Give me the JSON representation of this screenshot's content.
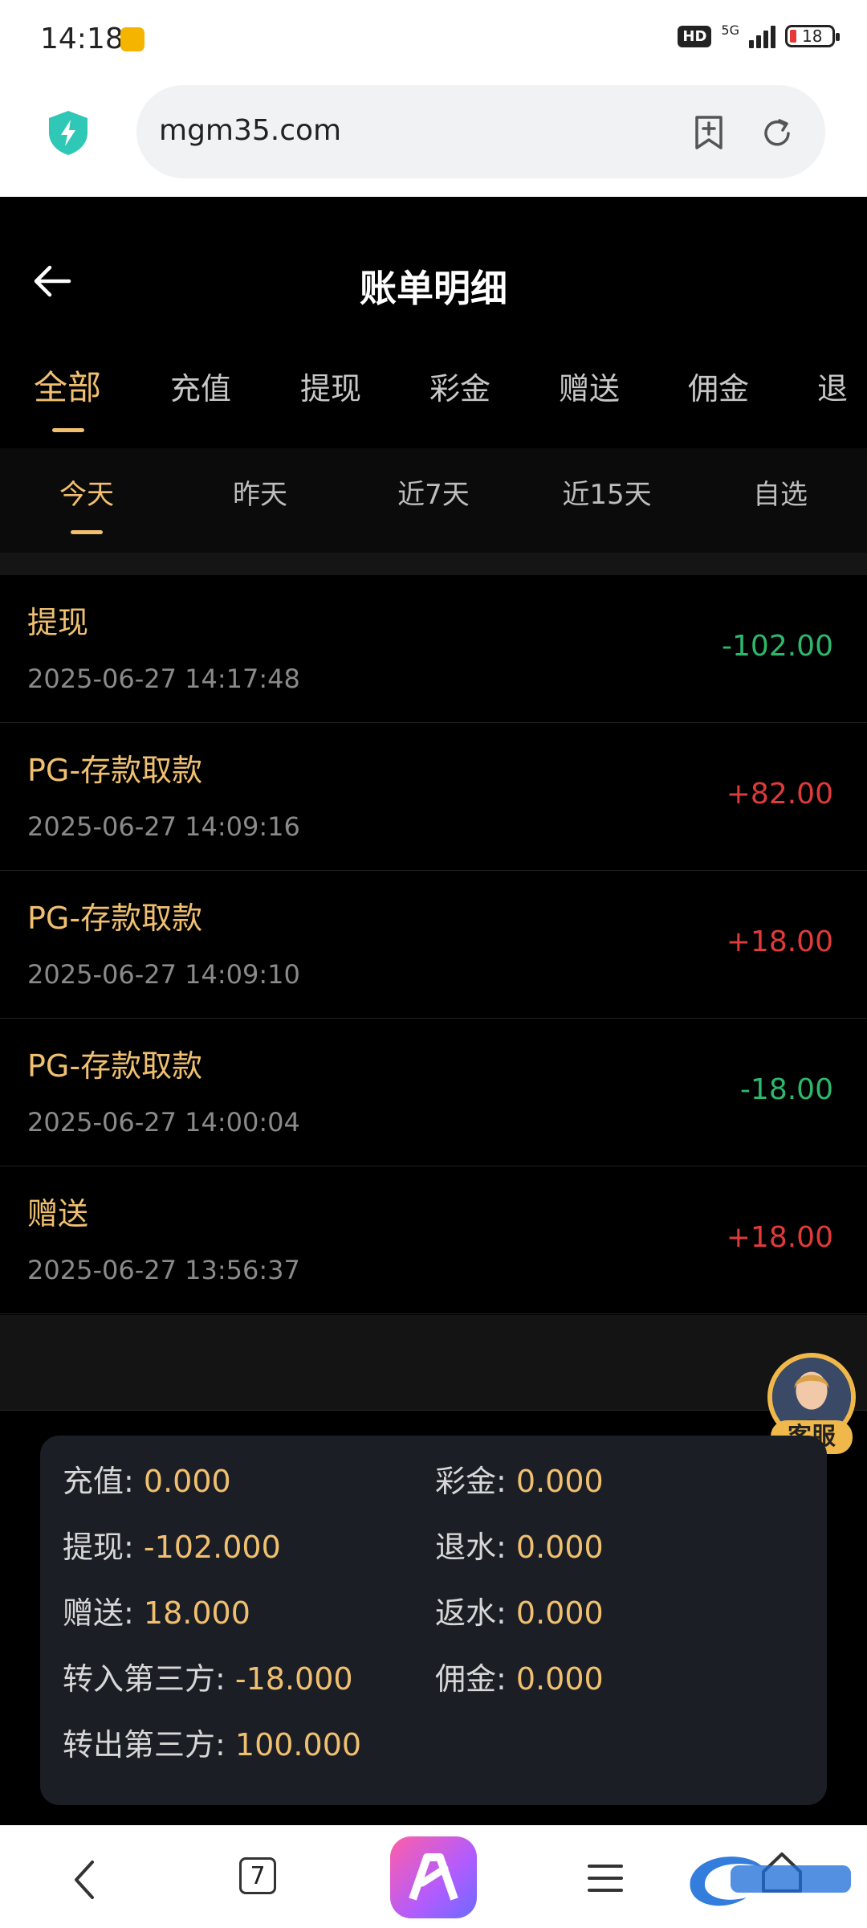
{
  "status_bar": {
    "time": "14:18",
    "hd_badge": "HD",
    "network": "5G",
    "battery": "18"
  },
  "browser": {
    "url": "mgm35.com"
  },
  "header": {
    "title": "账单明细"
  },
  "category_tabs": [
    {
      "label": "全部"
    },
    {
      "label": "充值"
    },
    {
      "label": "提现"
    },
    {
      "label": "彩金"
    },
    {
      "label": "赠送"
    },
    {
      "label": "佣金"
    },
    {
      "label": "退"
    }
  ],
  "date_tabs": [
    {
      "label": "今天"
    },
    {
      "label": "昨天"
    },
    {
      "label": "近7天"
    },
    {
      "label": "近15天"
    },
    {
      "label": "自选"
    }
  ],
  "records": [
    {
      "title": "提现",
      "time": "2025-06-27 14:17:48",
      "amount": "-102.00",
      "color": "#2db86b"
    },
    {
      "title": "PG-存款取款",
      "time": "2025-06-27 14:09:16",
      "amount": "+82.00",
      "color": "#e03a3a"
    },
    {
      "title": "PG-存款取款",
      "time": "2025-06-27 14:09:10",
      "amount": "+18.00",
      "color": "#e03a3a"
    },
    {
      "title": "PG-存款取款",
      "time": "2025-06-27 14:00:04",
      "amount": "-18.00",
      "color": "#2db86b"
    },
    {
      "title": "赠送",
      "time": "2025-06-27 13:56:37",
      "amount": "+18.00",
      "color": "#e03a3a"
    }
  ],
  "support": {
    "label": "客服"
  },
  "summary": {
    "recharge": {
      "label": "充值:",
      "value": "0.000"
    },
    "bonus": {
      "label": "彩金:",
      "value": "0.000"
    },
    "withdraw": {
      "label": "提现:",
      "value": "-102.000"
    },
    "rebate": {
      "label": "退水:",
      "value": "0.000"
    },
    "gift": {
      "label": "赠送:",
      "value": "18.000"
    },
    "cashback": {
      "label": "返水:",
      "value": "0.000"
    },
    "transfer_in": {
      "label": "转入第三方:",
      "value": "-18.000"
    },
    "commission": {
      "label": "佣金:",
      "value": "0.000"
    },
    "transfer_out": {
      "label": "转出第三方:",
      "value": "100.000"
    }
  },
  "bottom_nav": {
    "tabs_count": "7"
  },
  "colors": {
    "accent": "#f0c070",
    "positive": "#e03a3a",
    "negative": "#2db86b"
  }
}
